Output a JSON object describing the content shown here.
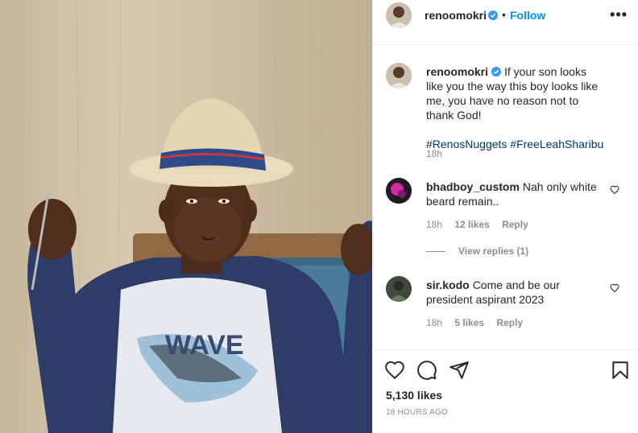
{
  "post": {
    "username": "renoomokri",
    "follow_label": "Follow",
    "dot": "•",
    "more_label": "•••",
    "caption": "If your son looks like you the way this boy looks like me, you have no reason not to thank God!",
    "hashtags": "#RenosNuggets #FreeLeahSharibu",
    "caption_time": "18h",
    "photo_shirt_text": "WAVE",
    "likes": "5,130 likes",
    "posted_ago": "18 HOURS AGO"
  },
  "comments": [
    {
      "username": "bhadboy_custom",
      "text": "Nah only white beard remain..",
      "time": "18h",
      "likes": "12 likes",
      "reply": "Reply",
      "view_replies": "View replies (1)"
    },
    {
      "username": "sir.kodo",
      "text": "Come and be our president aspirant 2023",
      "time": "18h",
      "likes": "5 likes",
      "reply": "Reply"
    }
  ],
  "icons": {
    "verified": "verified-badge-icon",
    "more": "more-options-icon",
    "heart": "heart-icon",
    "comment": "comment-icon",
    "share": "share-icon",
    "save": "bookmark-icon"
  },
  "colors": {
    "link": "#0095f6",
    "hashtag": "#00376b",
    "muted": "#8e8e8e",
    "text": "#262626"
  }
}
